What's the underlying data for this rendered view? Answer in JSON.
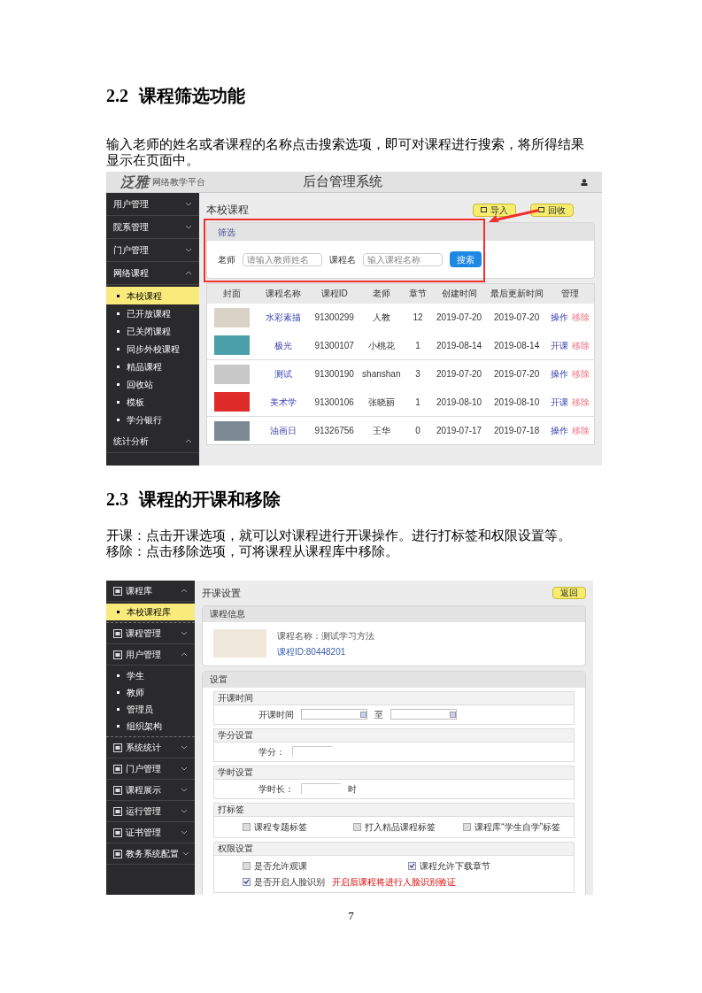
{
  "sections": [
    {
      "number": "2.2",
      "title": "课程筛选功能",
      "paragraphs": [
        "输入老师的姓名或者课程的名称点击搜索选项，即可对课程进行搜索，将所得结果显示在页面中。"
      ],
      "figure": {
        "kind": "course_list",
        "header": {
          "logo": "泛雅",
          "logo_subtitle": "网络教学平台",
          "title": "后台管理系统"
        },
        "sidebar": [
          {
            "label": "用户管理",
            "expanded": false
          },
          {
            "label": "院系管理",
            "expanded": false
          },
          {
            "label": "门户管理",
            "expanded": false
          },
          {
            "label": "网络课程",
            "expanded": true,
            "children": [
              {
                "label": "本校课程",
                "selected": true
              },
              {
                "label": "已开放课程",
                "selected": false
              },
              {
                "label": "已关闭课程",
                "selected": false
              },
              {
                "label": "同步外校课程",
                "selected": false
              },
              {
                "label": "精品课程",
                "selected": false
              },
              {
                "label": "回收站",
                "selected": false
              },
              {
                "label": "模板",
                "selected": false
              },
              {
                "label": "学分银行",
                "selected": false
              }
            ]
          },
          {
            "label": "统计分析",
            "expanded": true
          }
        ],
        "page_title": "本校课程",
        "buttons": [
          "导入",
          "回收"
        ],
        "filter": {
          "title": "筛选",
          "fields": [
            {
              "label": "老师",
              "placeholder": "请输入教师姓名"
            },
            {
              "label": "课程名",
              "placeholder": "输入课程名称"
            }
          ],
          "button": "搜索"
        },
        "annotation": {
          "highlight_box": true,
          "arrow": true
        },
        "table": {
          "columns": [
            "封面",
            "课程名称",
            "课程ID",
            "老师",
            "章节",
            "创建时间",
            "最后更新时间",
            "管理"
          ],
          "rows": [
            {
              "name": "水彩素描",
              "id": "91300299",
              "teacher": "人教",
              "chapters": "12",
              "created": "2019-07-20",
              "updated": "2019-07-20",
              "actions": [
                "操作",
                "移除"
              ]
            },
            {
              "name": "极光",
              "id": "91300107",
              "teacher": "小桃花",
              "chapters": "1",
              "created": "2019-08-14",
              "updated": "2019-08-14",
              "actions": [
                "开课",
                "移除"
              ]
            },
            {
              "name": "测试",
              "id": "91300190",
              "teacher": "shanshan",
              "chapters": "3",
              "created": "2019-07-20",
              "updated": "2019-07-20",
              "actions": [
                "操作",
                "移除"
              ]
            },
            {
              "name": "美术学",
              "id": "91300106",
              "teacher": "张晓丽",
              "chapters": "1",
              "created": "2019-08-10",
              "updated": "2019-08-10",
              "actions": [
                "开课",
                "移除"
              ]
            },
            {
              "name": "油画日",
              "id": "91326756",
              "teacher": "王华",
              "chapters": "0",
              "created": "2019-07-17",
              "updated": "2019-07-18",
              "actions": [
                "操作",
                "移除"
              ]
            }
          ]
        }
      }
    },
    {
      "number": "2.3",
      "title": "课程的开课和移除",
      "paragraphs": [
        "开课：点击开课选项，就可以对课程进行开课操作。进行打标签和权限设置等。",
        "移除：点击移除选项，可将课程从课程库中移除。"
      ],
      "figure": {
        "kind": "course_settings",
        "sidebar": [
          {
            "label": "课程库",
            "expanded": true,
            "children": [
              {
                "label": "本校课程库",
                "selected": true
              }
            ]
          },
          {
            "label": "课程管理",
            "expanded": false
          },
          {
            "label": "用户管理",
            "expanded": true,
            "children": [
              {
                "label": "学生",
                "selected": false
              },
              {
                "label": "教师",
                "selected": false
              },
              {
                "label": "管理员",
                "selected": false
              },
              {
                "label": "组织架构",
                "selected": false
              }
            ]
          },
          {
            "label": "系统统计",
            "expanded": false
          },
          {
            "label": "门户管理",
            "expanded": false
          },
          {
            "label": "课程展示",
            "expanded": false
          },
          {
            "label": "运行管理",
            "expanded": false
          },
          {
            "label": "证书管理",
            "expanded": false
          },
          {
            "label": "教务系统配置",
            "expanded": false
          }
        ],
        "page_title": "开课设置",
        "back_button": "返回",
        "course_info": {
          "title": "课程信息",
          "name": "课程名称：测试学习方法",
          "id": "课程ID:80448201"
        },
        "settings": {
          "title": "设置",
          "sections": [
            {
              "title": "开课时间",
              "kind": "date_range",
              "label": "开课时间",
              "separator": "至"
            },
            {
              "title": "学分设置",
              "kind": "input",
              "label": "学分："
            },
            {
              "title": "学时设置",
              "kind": "input",
              "label": "学时长：",
              "unit": "时"
            },
            {
              "title": "打标签",
              "kind": "checkbox_row",
              "options": [
                {
                  "label": "课程专题标签",
                  "checked": false
                },
                {
                  "label": "打入精品课程标签",
                  "checked": false
                },
                {
                  "label": "课程库“学生自学”标签",
                  "checked": false
                }
              ]
            },
            {
              "title": "权限设置",
              "kind": "checkbox_grid",
              "options": [
                {
                  "label": "是否允许观课",
                  "checked": false
                },
                {
                  "label": "课程允许下载章节",
                  "checked": true
                },
                {
                  "label": "是否开启人脸识别",
                  "checked": true,
                  "note": "开启后课程将进行人脸识别验证"
                }
              ]
            }
          ]
        }
      }
    }
  ],
  "page_number": "7"
}
